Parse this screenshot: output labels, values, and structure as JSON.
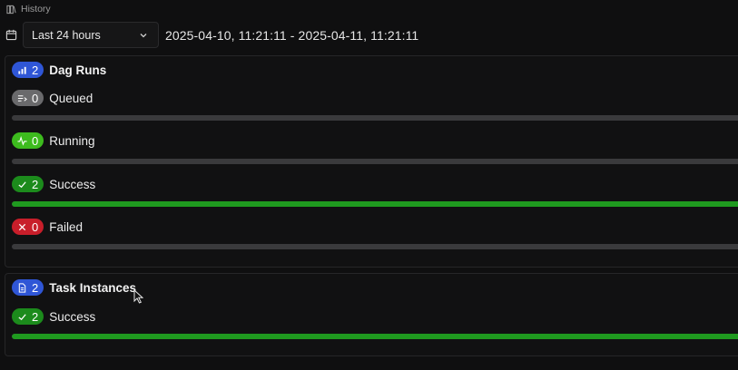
{
  "header": {
    "title": "History",
    "icon": "history-icon"
  },
  "time_range": {
    "selected": "Last 24 hours",
    "range_text": "2025-04-10, 11:21:11 - 2025-04-11, 11:21:11"
  },
  "dag_runs": {
    "title": "Dag Runs",
    "total": "2",
    "states": [
      {
        "label": "Queued",
        "count": "0",
        "color": "#6a6a6c",
        "fill": 0
      },
      {
        "label": "Running",
        "count": "0",
        "color": "#3dbb1e",
        "fill": 0
      },
      {
        "label": "Success",
        "count": "2",
        "color": "#1c8b1c",
        "fill": 1
      },
      {
        "label": "Failed",
        "count": "0",
        "color": "#c81e2a",
        "fill": 0
      }
    ]
  },
  "task_instances": {
    "title": "Task Instances",
    "total": "2",
    "states": [
      {
        "label": "Success",
        "count": "2",
        "color": "#1c8b1c",
        "fill": 1
      }
    ]
  },
  "colors": {
    "accent_blue": "#2f56d6",
    "bar_fill": "#1f9a1f",
    "bar_track": "#3a3a3c"
  }
}
